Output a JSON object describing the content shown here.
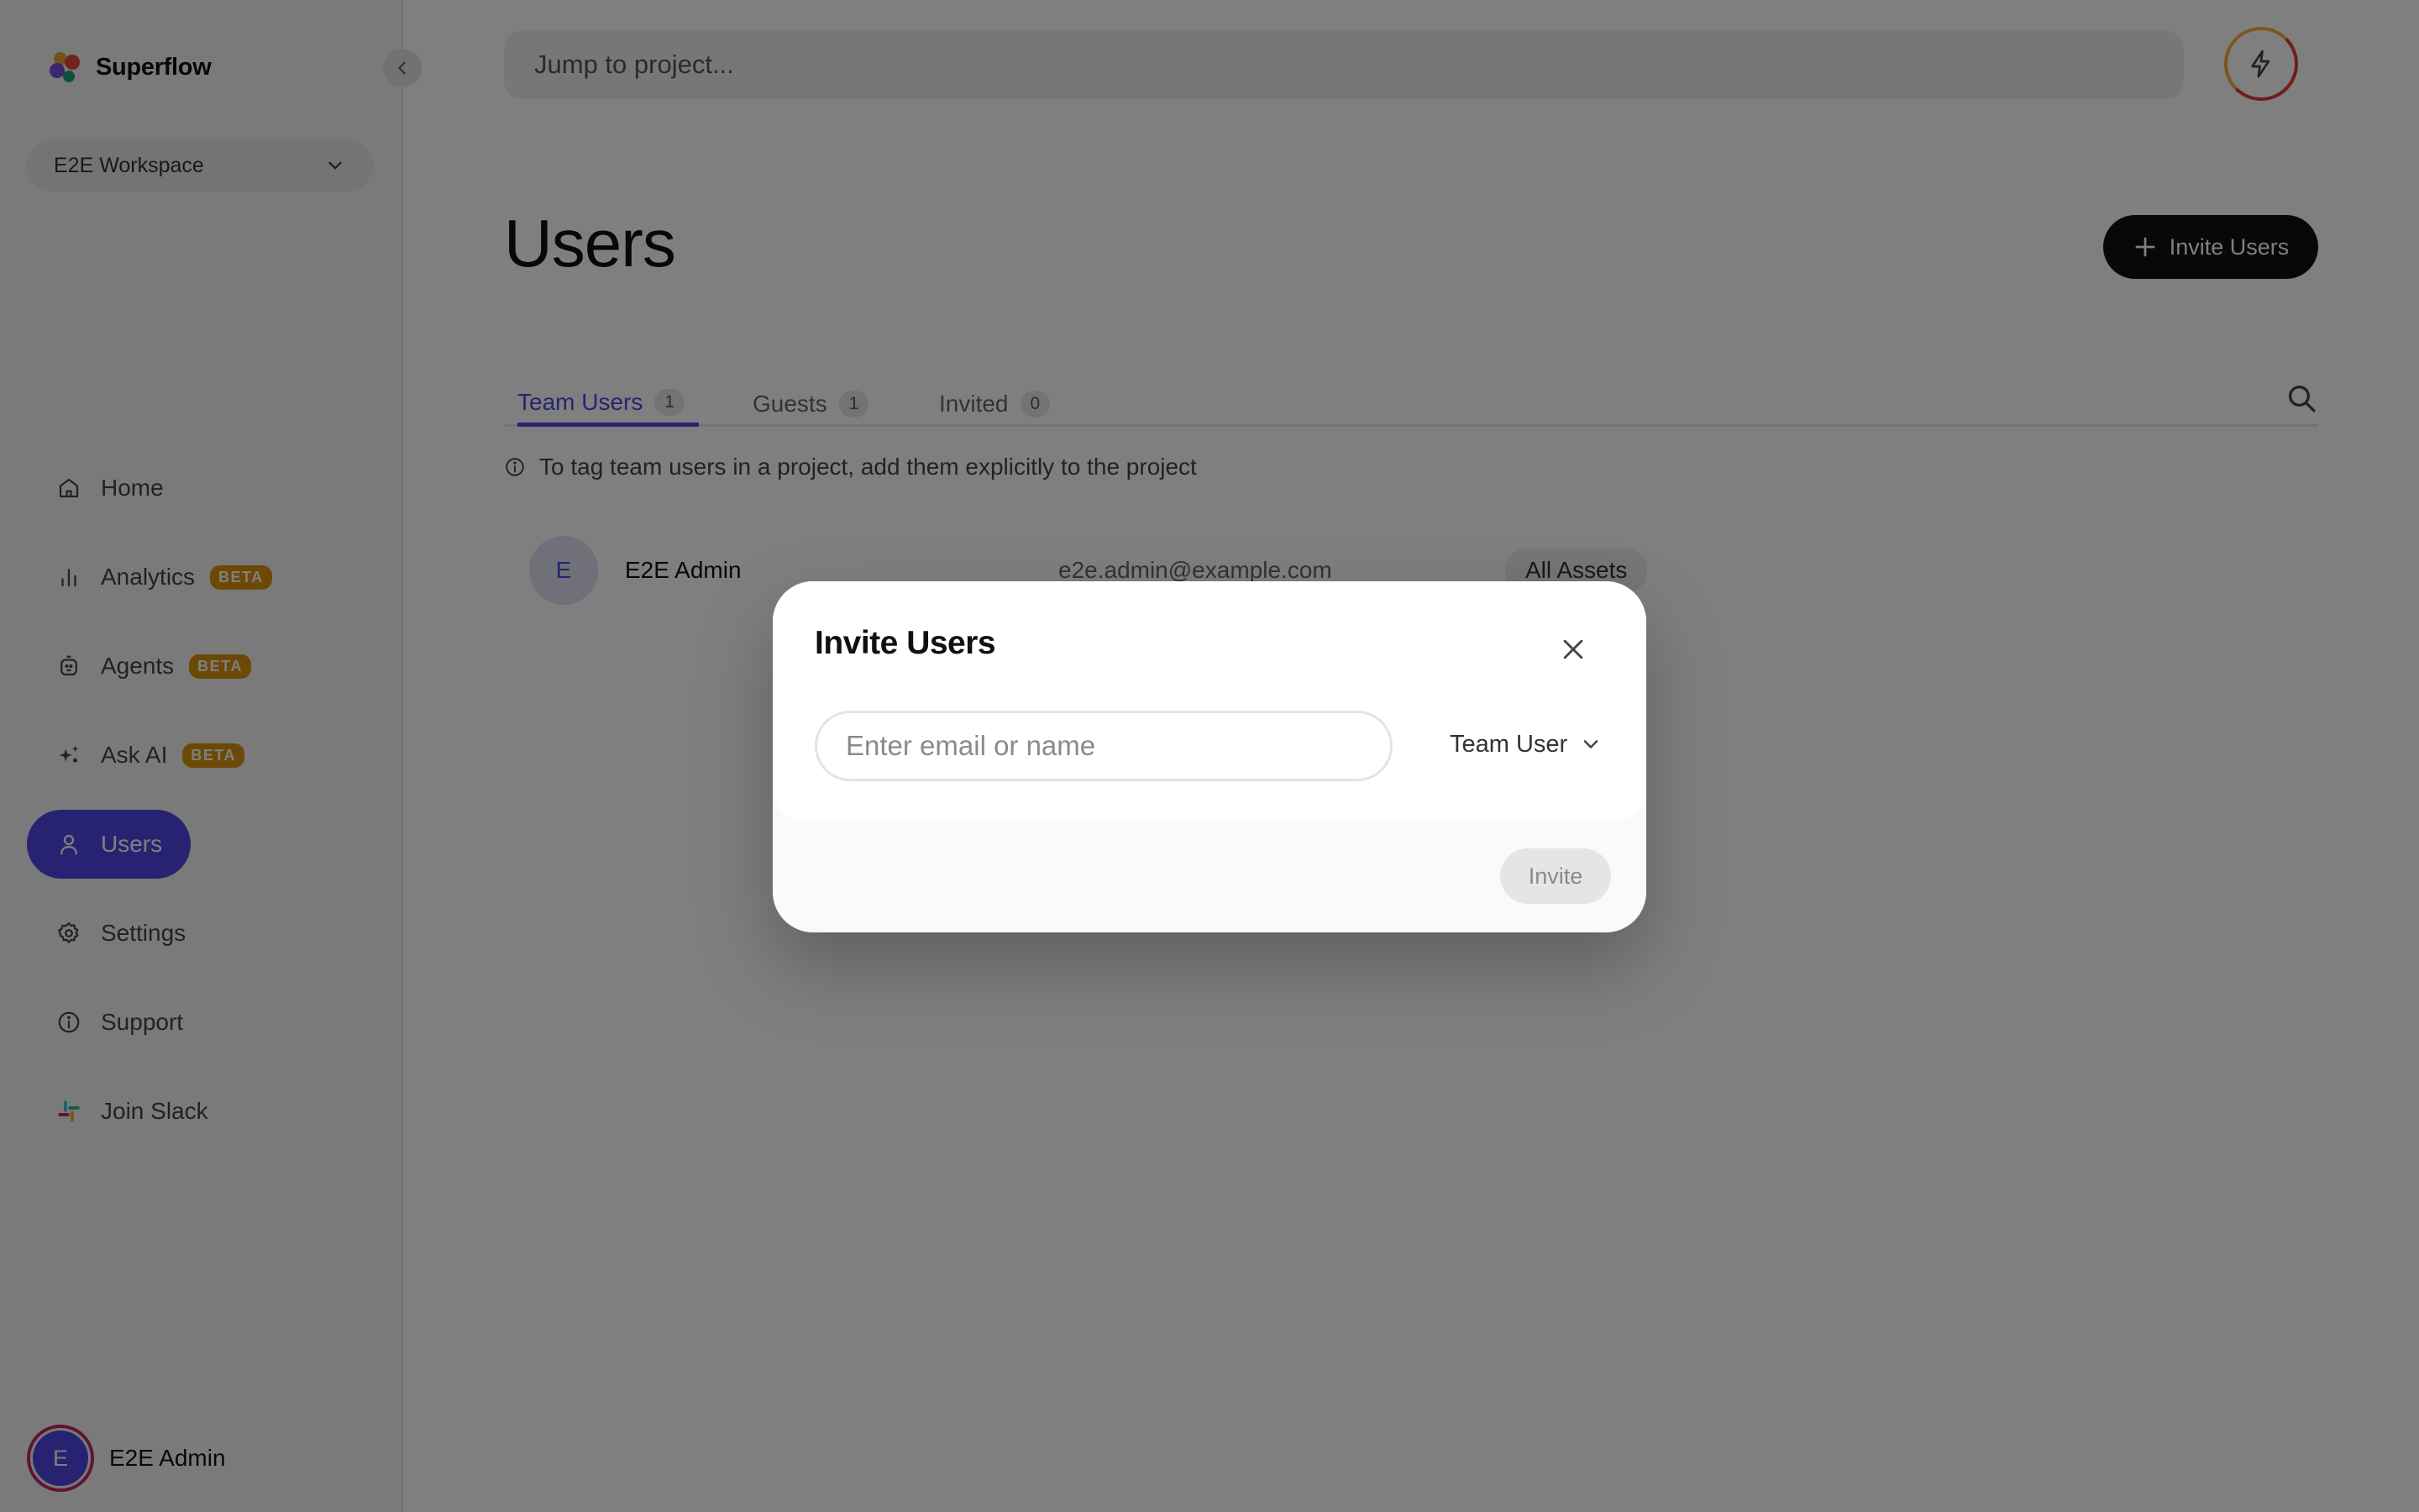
{
  "app": {
    "name": "Superflow"
  },
  "sidebar": {
    "workspace": "E2E Workspace",
    "items": [
      {
        "label": "Home",
        "icon": "home-icon",
        "beta": ""
      },
      {
        "label": "Analytics",
        "icon": "bar-chart-icon",
        "beta": "BETA"
      },
      {
        "label": "Agents",
        "icon": "agent-icon",
        "beta": "BETA"
      },
      {
        "label": "Ask AI",
        "icon": "sparkles-icon",
        "beta": "BETA"
      },
      {
        "label": "Users",
        "icon": "user-icon",
        "beta": "",
        "active": true
      },
      {
        "label": "Settings",
        "icon": "gear-icon",
        "beta": ""
      },
      {
        "label": "Support",
        "icon": "info-icon",
        "beta": ""
      },
      {
        "label": "Join Slack",
        "icon": "slack-icon",
        "beta": ""
      }
    ],
    "current_user": {
      "initial": "E",
      "name": "E2E Admin"
    }
  },
  "header": {
    "search_placeholder": "Jump to project..."
  },
  "main": {
    "title": "Users",
    "invite_button": "Invite Users",
    "tabs": [
      {
        "label": "Team Users",
        "count": "1",
        "active": true
      },
      {
        "label": "Guests",
        "count": "1"
      },
      {
        "label": "Invited",
        "count": "0"
      }
    ],
    "hint": "To tag team users in a project, add them explicitly to the project",
    "rows": [
      {
        "initial": "E",
        "name": "E2E Admin",
        "email": "e2e.admin@example.com",
        "access": "All Assets"
      }
    ]
  },
  "modal": {
    "title": "Invite Users",
    "input_placeholder": "Enter email or name",
    "role": "Team User",
    "invite_label": "Invite"
  },
  "colors": {
    "accent": "#4f46e5",
    "beta": "#d9920a",
    "dark_button": "#111111"
  }
}
